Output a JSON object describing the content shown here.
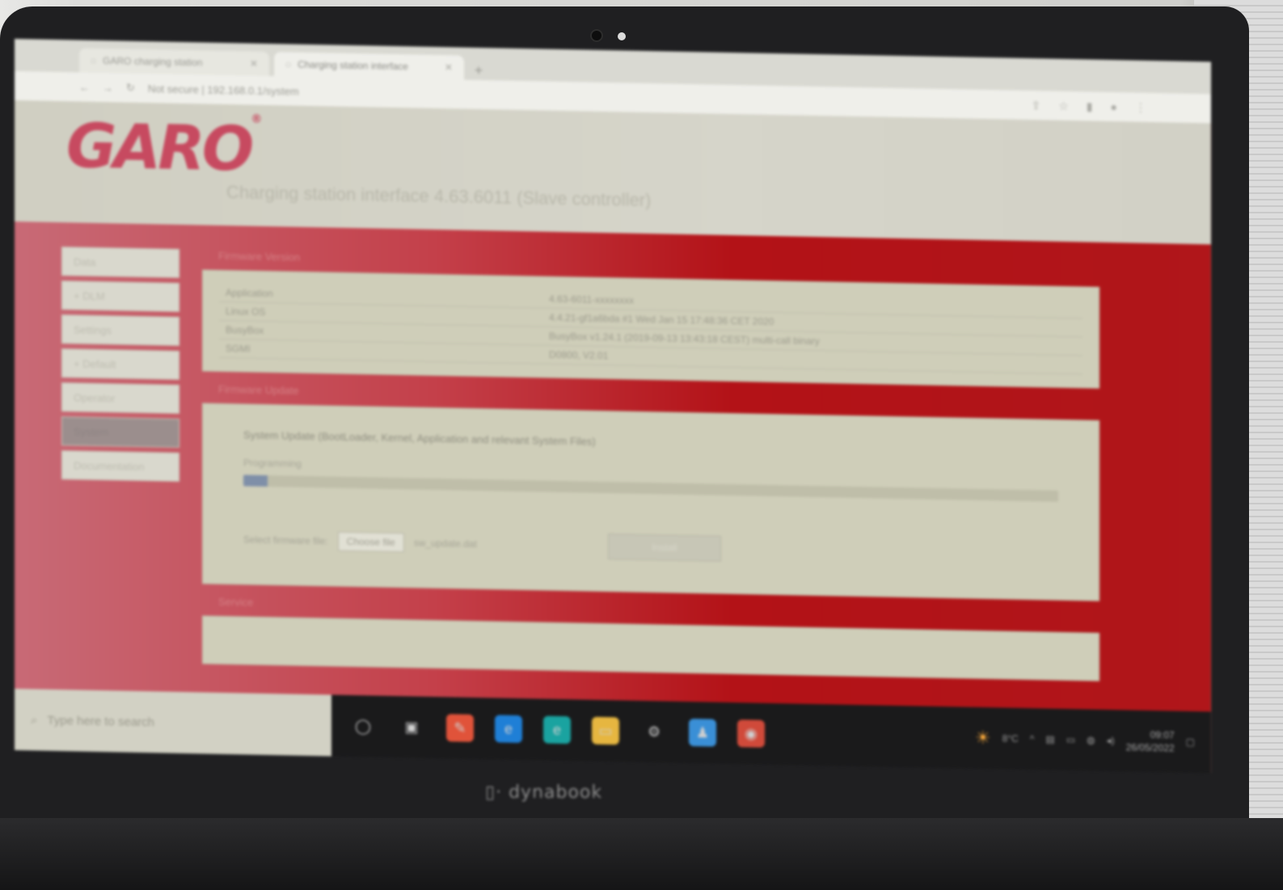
{
  "browser": {
    "tabs": [
      {
        "label": "GARO charging station",
        "active": false
      },
      {
        "label": "Charging station interface",
        "active": true
      }
    ],
    "url": "Not secure | 192.168.0.1/system",
    "new_tab": "+"
  },
  "header": {
    "logo_text": "GARO",
    "logo_mark": "®",
    "title": "Charging station interface 4.63.6011 (Slave controller)"
  },
  "sidebar": {
    "items": [
      {
        "label": "Data",
        "active": false
      },
      {
        "label": "+ DLM",
        "active": false
      },
      {
        "label": "Settings",
        "active": false
      },
      {
        "label": "+ Default",
        "active": false
      },
      {
        "label": "Operator",
        "active": false
      },
      {
        "label": "System",
        "active": true
      },
      {
        "label": "Documentation",
        "active": false
      }
    ]
  },
  "versions": {
    "section_title": "Firmware Version",
    "rows": [
      {
        "label": "Application",
        "value": "4.63-6011-xxxxxxxx"
      },
      {
        "label": "Linux OS",
        "value": "4.4.21-gf1a6bda #1 Wed Jan 15 17:48:36 CET 2020"
      },
      {
        "label": "BusyBox",
        "value": "BusyBox v1.24.1 (2019-09-13 13:43:18 CEST) multi-call binary"
      },
      {
        "label": "SGMI",
        "value": "D0800, V2.01"
      }
    ]
  },
  "firmware_update": {
    "section_title": "Firmware Update",
    "description": "System Update (BootLoader, Kernel, Application and relevant System Files)",
    "progress_label": "Programming",
    "progress": 0.03,
    "file_label": "Select firmware file:",
    "choose_button": "Choose file",
    "file_name": "sw_update.dat",
    "install_button": "Install"
  },
  "service": {
    "section_title": "Service"
  },
  "taskbar": {
    "search_placeholder": "Type here to search",
    "temperature": "8°C",
    "time": "09:07",
    "date": "26/05/2022"
  },
  "device": {
    "brand": "dynabook"
  },
  "colors": {
    "brand_red": "#b31217",
    "logo_pink": "#c74a60"
  }
}
